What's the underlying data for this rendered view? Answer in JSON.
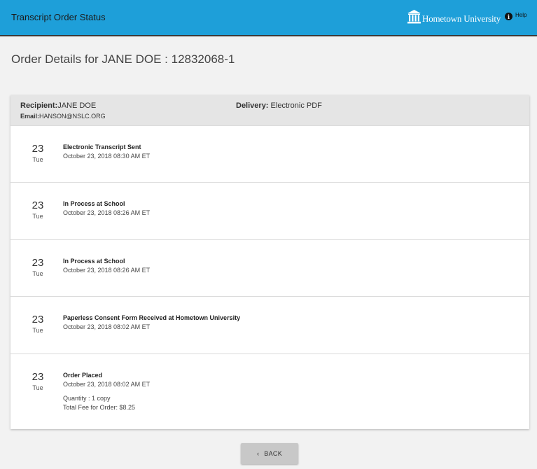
{
  "header": {
    "app_title": "Transcript Order Status",
    "logo_text": "Hometown University",
    "help_label": "Help",
    "help_icon": "info-icon",
    "bg_color": "#1e9fd9"
  },
  "page": {
    "title": "Order Details for JANE DOE : 12832068-1"
  },
  "order": {
    "recipient_label": "Recipient:",
    "recipient_value": "JANE DOE",
    "email_label": "Email:",
    "email_value": "HANSON@NSLC.ORG",
    "delivery_label": "Delivery:",
    "delivery_value": " Electronic PDF"
  },
  "events": [
    {
      "day": "23",
      "dow": "Tue",
      "title": "Electronic Transcript Sent",
      "time": "October 23, 2018 08:30 AM ET"
    },
    {
      "day": "23",
      "dow": "Tue",
      "title": "In Process at School",
      "time": "October 23, 2018 08:26 AM ET"
    },
    {
      "day": "23",
      "dow": "Tue",
      "title": "In Process at School",
      "time": "October 23, 2018 08:26 AM ET"
    },
    {
      "day": "23",
      "dow": "Tue",
      "title": "Paperless Consent Form Received at Hometown University",
      "time": "October 23, 2018 08:02 AM ET"
    },
    {
      "day": "23",
      "dow": "Tue",
      "title": "Order Placed",
      "time": "October 23, 2018 08:02 AM ET",
      "quantity": "Quantity : 1 copy",
      "fee": "Total Fee for Order: $8.25"
    }
  ],
  "back_button": {
    "label": "BACK",
    "icon": "chevron-left-icon"
  }
}
